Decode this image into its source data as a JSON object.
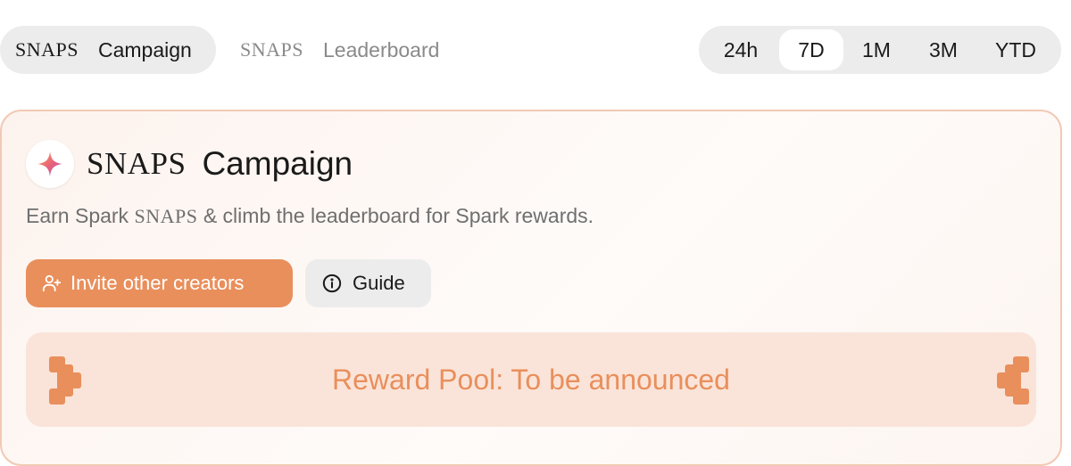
{
  "nav": {
    "campaign_tab": {
      "brand": "SNAPS",
      "label": "Campaign"
    },
    "leaderboard_tab": {
      "brand": "SNAPS",
      "label": "Leaderboard"
    },
    "time_filters": [
      "24h",
      "7D",
      "1M",
      "3M",
      "YTD"
    ],
    "selected_time_filter": "7D"
  },
  "card": {
    "icon": "spark-star-icon",
    "brand": "SNAPS",
    "title": "Campaign",
    "subtitle_pre": "Earn Spark ",
    "subtitle_brand": "SNAPS",
    "subtitle_post": " & climb the leaderboard for Spark rewards.",
    "invite_button": "Invite other creators",
    "guide_button": "Guide",
    "reward_pool": "Reward Pool: To be announced"
  },
  "colors": {
    "accent": "#e98f5c",
    "reward_bg": "#fae4d9",
    "card_border": "#f1c9b4"
  }
}
